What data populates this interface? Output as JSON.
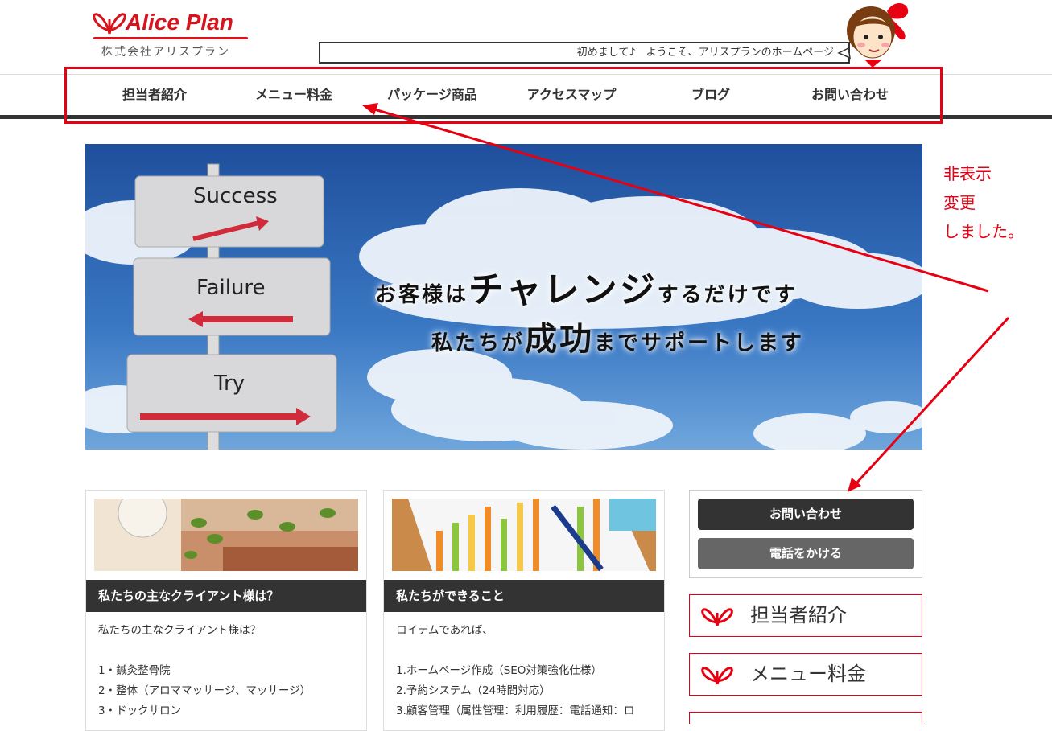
{
  "header": {
    "logo_brand": "Alice Plan",
    "logo_company": "株式会社アリスプラン",
    "ticker_text": "初めまして♪　ようこそ、アリスプランのホームページ",
    "mascot_icon": "girl-mascot-icon"
  },
  "nav": {
    "items": [
      {
        "label": "担当者紹介"
      },
      {
        "label": "メニュー料金"
      },
      {
        "label": "パッケージ商品"
      },
      {
        "label": "アクセスマップ"
      },
      {
        "label": "ブログ"
      },
      {
        "label": "お問い合わせ"
      }
    ]
  },
  "hero": {
    "sign1": "Success",
    "sign2": "Failure",
    "sign3": "Try",
    "line1_a": "お客様は",
    "line1_big": "チャレンジ",
    "line1_b": "するだけです",
    "line2_a": "私たちが",
    "line2_big": "成功",
    "line2_b": "までサポートします"
  },
  "cards": [
    {
      "title": "私たちの主なクライアント様は？",
      "lines": [
        "私たちの主なクライアント様は？",
        "",
        "1・鍼灸整骨院",
        "2・整体（アロママッサージ、マッサージ）",
        "3・ドックサロン"
      ]
    },
    {
      "title": "私たちができること",
      "lines": [
        "ロイテムであれば、",
        "",
        "1.ホームページ作成（SEO対策強化仕様）",
        "2.予約システム（24時間対応）",
        "3.顧客管理（属性管理：利用履歴：電話通知：ロ"
      ]
    }
  ],
  "sidebar": {
    "contact_button": "お問い合わせ",
    "phone_button": "電話をかける",
    "links": [
      {
        "label": "担当者紹介"
      },
      {
        "label": "メニュー料金"
      },
      {
        "label": ""
      }
    ]
  },
  "annotation": {
    "line1": "非表示",
    "line2": "変更",
    "line3": "しました。"
  },
  "colors": {
    "accent_red": "#e60012",
    "nav_dark": "#333333",
    "sky_blue": "#2a5ca8"
  }
}
